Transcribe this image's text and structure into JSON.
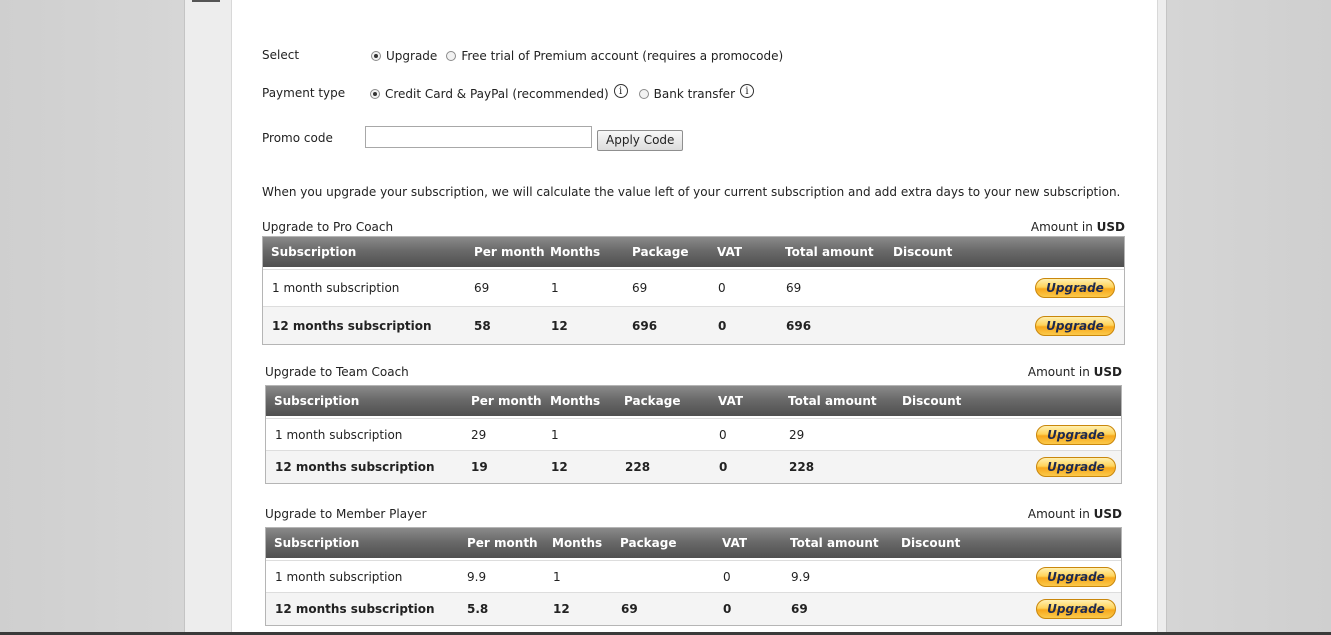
{
  "form": {
    "select_label": "Select",
    "select_options": [
      "Upgrade",
      "Free trial of Premium account (requires a promocode)"
    ],
    "payment_label": "Payment type",
    "payment_options": [
      "Credit Card & PayPal (recommended)",
      "Bank transfer"
    ],
    "promo_label": "Promo code",
    "promo_value": "",
    "apply_label": "Apply Code",
    "info_glyph": "i"
  },
  "note": "When you upgrade your subscription, we will calculate the value left of your current subscription and add extra days to your new subscription.",
  "amount_prefix": "Amount in",
  "currency": "USD",
  "headers": [
    "Subscription",
    "Per month",
    "Months",
    "Package",
    "VAT",
    "Total amount",
    "Discount"
  ],
  "upgrade_label": "Upgrade",
  "sections": [
    {
      "title": "Upgrade to Pro Coach",
      "rows": [
        {
          "subscription": "1 month subscription",
          "per_month": "69",
          "months": "1",
          "package": "69",
          "vat": "0",
          "total": "69",
          "discount": ""
        },
        {
          "subscription": "12 months subscription",
          "per_month": "58",
          "months": "12",
          "package": "696",
          "vat": "0",
          "total": "696",
          "discount": ""
        }
      ]
    },
    {
      "title": "Upgrade to Team Coach",
      "rows": [
        {
          "subscription": "1 month subscription",
          "per_month": "29",
          "months": "1",
          "package": "",
          "vat": "0",
          "total": "29",
          "discount": ""
        },
        {
          "subscription": "12 months subscription",
          "per_month": "19",
          "months": "12",
          "package": "228",
          "vat": "0",
          "total": "228",
          "discount": ""
        }
      ]
    },
    {
      "title": "Upgrade to Member Player",
      "rows": [
        {
          "subscription": "1 month subscription",
          "per_month": "9.9",
          "months": "1",
          "package": "",
          "vat": "0",
          "total": "9.9",
          "discount": ""
        },
        {
          "subscription": "12 months subscription",
          "per_month": "5.8",
          "months": "12",
          "package": "69",
          "vat": "0",
          "total": "69",
          "discount": ""
        }
      ]
    }
  ]
}
